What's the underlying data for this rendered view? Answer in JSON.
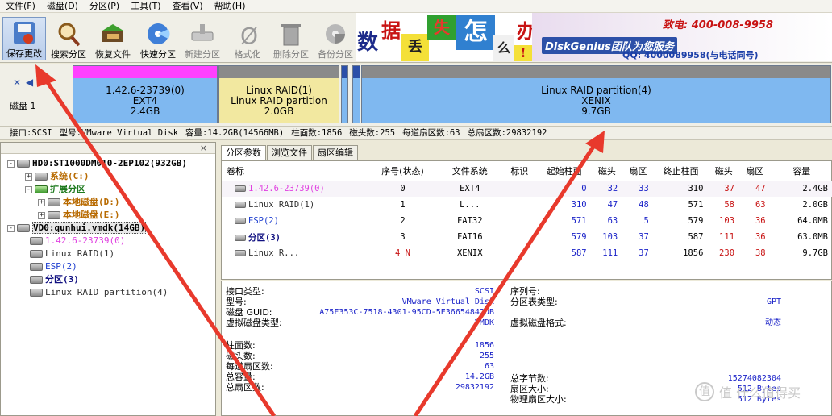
{
  "menu": [
    "文件(F)",
    "磁盘(D)",
    "分区(P)",
    "工具(T)",
    "查看(V)",
    "帮助(H)"
  ],
  "toolbar": [
    {
      "id": "save",
      "label": "保存更改",
      "icon": "save-icon",
      "enabled": true
    },
    {
      "id": "search",
      "label": "搜索分区",
      "icon": "magnifier-icon",
      "enabled": true
    },
    {
      "id": "recover",
      "label": "恢复文件",
      "icon": "recover-icon",
      "enabled": true
    },
    {
      "id": "quick",
      "label": "快速分区",
      "icon": "quick-partition-icon",
      "enabled": true
    },
    {
      "id": "new",
      "label": "新建分区",
      "icon": "new-partition-icon",
      "enabled": false
    },
    {
      "id": "format",
      "label": "格式化",
      "icon": "format-icon",
      "enabled": false
    },
    {
      "id": "delete",
      "label": "删除分区",
      "icon": "trash-icon",
      "enabled": false
    },
    {
      "id": "backup",
      "label": "备份分区",
      "icon": "backup-icon",
      "enabled": false
    }
  ],
  "banner": {
    "chars": [
      "数",
      "据",
      "丢",
      "失",
      "怎",
      "么",
      "办",
      "!"
    ],
    "team": "DiskGenius团队为您服务",
    "phone_label": "致电:",
    "phone": "400-008-9958",
    "qq": "QQ: 4000089958(与电话同号)"
  },
  "diskmap": {
    "nav": "× ◀ ▶",
    "disk_label": "磁盘 1",
    "partitions": [
      {
        "line1": "1.42.6-23739(0)",
        "line2": "EXT4",
        "line3": "2.4GB",
        "color": "#7fb8f0",
        "bar": "#ff40ff"
      },
      {
        "line1": "Linux RAID(1)",
        "line2": "Linux RAID partition",
        "line3": "2.0GB",
        "color": "#f2e8a0",
        "bar": "#8a8a8a"
      },
      {
        "line1": "",
        "line2": "",
        "line3": "",
        "color": "#7fb8f0",
        "bar": "#2b4fa8"
      },
      {
        "line1": "",
        "line2": "",
        "line3": "",
        "color": "#7fb8f0",
        "bar": "#2b4fa8"
      },
      {
        "line1": "Linux RAID partition(4)",
        "line2": "XENIX",
        "line3": "9.7GB",
        "color": "#7fb8f0",
        "bar": "#8a8a8a"
      }
    ]
  },
  "disk_info": [
    "接口:SCSI",
    "型号:VMware Virtual Disk",
    "容量:14.2GB(14566MB)",
    "柱面数:1856",
    "磁头数:255",
    "每道扇区数:63",
    "总扇区数:29832192"
  ],
  "tree": [
    {
      "text": "HD0:ST1000DM010-2EP102(932GB)",
      "color": "#000",
      "bold": true,
      "icon": "disk-icon"
    },
    {
      "text": "系统(C:)",
      "color": "#b86a00",
      "bold": true,
      "icon": "partition-icon"
    },
    {
      "text": "扩展分区",
      "color": "#1e7a1e",
      "bold": true,
      "icon": "extended-partition-icon"
    },
    {
      "text": "本地磁盘(D:)",
      "color": "#b86a00",
      "bold": true,
      "icon": "partition-icon"
    },
    {
      "text": "本地磁盘(E:)",
      "color": "#b86a00",
      "bold": true,
      "icon": "partition-icon"
    },
    {
      "text": "VD0:qunhui.vmdk(14GB)",
      "color": "#000",
      "bold": true,
      "icon": "disk-icon"
    },
    {
      "text": "1.42.6-23739(0)",
      "color": "#e040e0",
      "bold": false,
      "icon": "partition-icon"
    },
    {
      "text": "Linux RAID(1)",
      "color": "#333",
      "bold": false,
      "icon": "partition-icon"
    },
    {
      "text": "ESP(2)",
      "color": "#2040d0",
      "bold": false,
      "icon": "partition-icon"
    },
    {
      "text": "分区(3)",
      "color": "#101080",
      "bold": true,
      "icon": "partition-icon"
    },
    {
      "text": "Linux RAID partition(4)",
      "color": "#333",
      "bold": false,
      "icon": "partition-icon"
    }
  ],
  "tabs": [
    "分区参数",
    "浏览文件",
    "扇区编辑"
  ],
  "table": {
    "headers": [
      "卷标",
      "序号(状态)",
      "文件系统",
      "标识",
      "起始柱面",
      "磁头",
      "扇区",
      "终止柱面",
      "磁头",
      "扇区",
      "容量"
    ],
    "rows": [
      {
        "name": "1.42.6-23739(0)",
        "name_color": "#e040e0",
        "idx": "0",
        "fs": "EXT4",
        "flag": "",
        "sc": "0",
        "sh": "32",
        "ss": "33",
        "ec": "310",
        "eh": "37",
        "es": "47",
        "cap": "2.4GB"
      },
      {
        "name": "Linux RAID(1)",
        "name_color": "#333",
        "idx": "1",
        "fs": "L...",
        "flag": "",
        "sc": "310",
        "sh": "47",
        "ss": "48",
        "ec": "571",
        "eh": "58",
        "es": "63",
        "cap": "2.0GB"
      },
      {
        "name": "ESP(2)",
        "name_color": "#2040d0",
        "idx": "2",
        "fs": "FAT32",
        "flag": "",
        "sc": "571",
        "sh": "63",
        "ss": "5",
        "ec": "579",
        "eh": "103",
        "es": "36",
        "cap": "64.0MB"
      },
      {
        "name": "分区(3)",
        "name_color": "#101080",
        "idx": "3",
        "fs": "FAT16",
        "flag": "",
        "sc": "579",
        "sh": "103",
        "ss": "37",
        "ec": "587",
        "eh": "111",
        "es": "36",
        "cap": "63.0MB"
      },
      {
        "name": "Linux R...",
        "name_color": "#333",
        "idx": "4 N",
        "fs": "XENIX",
        "flag": "",
        "sc": "587",
        "sh": "111",
        "ss": "37",
        "ec": "1856",
        "eh": "230",
        "es": "38",
        "cap": "9.7GB"
      }
    ]
  },
  "info": {
    "left_top": [
      {
        "label": "接口类型:",
        "value": "SCSI"
      },
      {
        "label": "型号:",
        "value": "VMware Virtual Disk"
      },
      {
        "label": "磁盘 GUID:",
        "value": "A75F353C-7518-4301-95CD-5E36654842DB"
      },
      {
        "label": "虚拟磁盘类型:",
        "value": "VMDK"
      }
    ],
    "right_top": [
      {
        "label": "序列号:",
        "value": ""
      },
      {
        "label": "分区表类型:",
        "value": "GPT"
      },
      {
        "label": "",
        "value": ""
      },
      {
        "label": "虚拟磁盘格式:",
        "value": "动态"
      }
    ],
    "left_bottom": [
      {
        "label": "柱面数:",
        "value": "1856"
      },
      {
        "label": "磁头数:",
        "value": "255"
      },
      {
        "label": "每道扇区数:",
        "value": "63"
      },
      {
        "label": "总容量:",
        "value": "14.2GB"
      },
      {
        "label": "总扇区数:",
        "value": "29832192"
      }
    ],
    "right_bottom": [
      {
        "label": "总字节数:",
        "value": "15274082304"
      },
      {
        "label": "扇区大小:",
        "value": "512 Bytes"
      },
      {
        "label": "物理扇区大小:",
        "value": "512 Bytes"
      }
    ]
  },
  "watermark": "值 什么值得买",
  "colors": {
    "arrow": "#e8392c",
    "selection": "#316ac5"
  }
}
